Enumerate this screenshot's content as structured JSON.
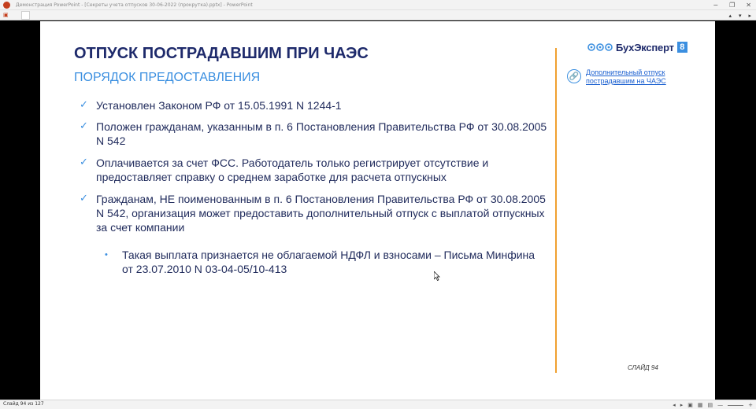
{
  "window": {
    "title": "Демонстрация PowerPoint - [Секреты учета отпусков 30-06-2022 (прокрутка).pptx] - PowerPoint",
    "controls": {
      "minimize": "−",
      "restore": "❐",
      "close": "✕"
    }
  },
  "toolbar": {
    "app_icon": "powerpoint-icon",
    "right_controls": [
      "▴",
      "▾",
      "▸"
    ]
  },
  "slide": {
    "title": "ОТПУСК ПОСТРАДАВШИМ ПРИ ЧАЭС",
    "subtitle": "ПОРЯДОК ПРЕДОСТАВЛЕНИЯ",
    "bullets": [
      "Установлен Законом РФ от 15.05.1991 N 1244-1",
      "Положен гражданам, указанным в п. 6 Постановления Правительства РФ от 30.08.2005 N 542",
      "Оплачивается за счет ФСС. Работодатель только регистрирует отсутствие и предоставляет справку о среднем заработке для расчета отпускных",
      "Гражданам, НЕ поименованным в п. 6 Постановления Правительства РФ от 30.08.2005 N 542, организация может предоставить дополнительный отпуск с выплатой отпускных за счет компании"
    ],
    "sub_bullet": "Такая выплата признается не облагаемой НДФЛ и взносами – Письма Минфина от 23.07.2010 N 03-04-05/10-413",
    "logo": {
      "text": "БухЭксперт",
      "badge": "8"
    },
    "side_link": "Дополнительный отпуск пострадавшим на ЧАЭС",
    "number_label": "СЛАЙД 94",
    "check_glyph": "✓",
    "dot_glyph": "•",
    "accent_color": "#3b8fe0",
    "title_color": "#1e2a6b",
    "divider_color": "#f0a030"
  },
  "status": {
    "slide_counter": "Слайд 94 из 127",
    "controls": [
      "◂",
      "▸",
      "▣",
      "▦",
      "▤",
      "—",
      "+"
    ]
  }
}
